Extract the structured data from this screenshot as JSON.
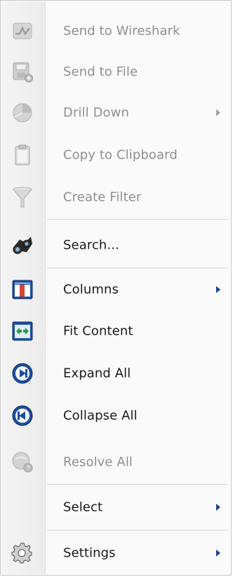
{
  "menu": {
    "items": [
      {
        "label": "Send to Wireshark",
        "icon": "wireshark-icon",
        "enabled": false,
        "submenu": false
      },
      {
        "label": "Send to File",
        "icon": "save-to-file-icon",
        "enabled": false,
        "submenu": false
      },
      {
        "label": "Drill Down",
        "icon": "drill-down-icon",
        "enabled": false,
        "submenu": true
      },
      {
        "label": "Copy to Clipboard",
        "icon": "clipboard-icon",
        "enabled": false,
        "submenu": false
      },
      {
        "label": "Create Filter",
        "icon": "funnel-icon",
        "enabled": false,
        "submenu": false
      },
      {
        "label": "Search...",
        "icon": "binoculars-icon",
        "enabled": true,
        "submenu": false
      },
      {
        "label": "Columns",
        "icon": "columns-icon",
        "enabled": true,
        "submenu": true
      },
      {
        "label": "Fit Content",
        "icon": "fit-content-icon",
        "enabled": true,
        "submenu": false
      },
      {
        "label": "Expand All",
        "icon": "expand-all-icon",
        "enabled": true,
        "submenu": false
      },
      {
        "label": "Collapse All",
        "icon": "collapse-all-icon",
        "enabled": true,
        "submenu": false
      },
      {
        "label": "Resolve All",
        "icon": "resolve-all-icon",
        "enabled": false,
        "submenu": false
      },
      {
        "label": "Select",
        "icon": "",
        "enabled": true,
        "submenu": true
      },
      {
        "label": "Settings",
        "icon": "gear-icon",
        "enabled": true,
        "submenu": true
      }
    ]
  },
  "colors": {
    "text": "#1a1a1a",
    "disabled_text": "#8f8f8f",
    "submenu_arrow": "#1a3f9a",
    "separator": "#d9d9d9"
  }
}
